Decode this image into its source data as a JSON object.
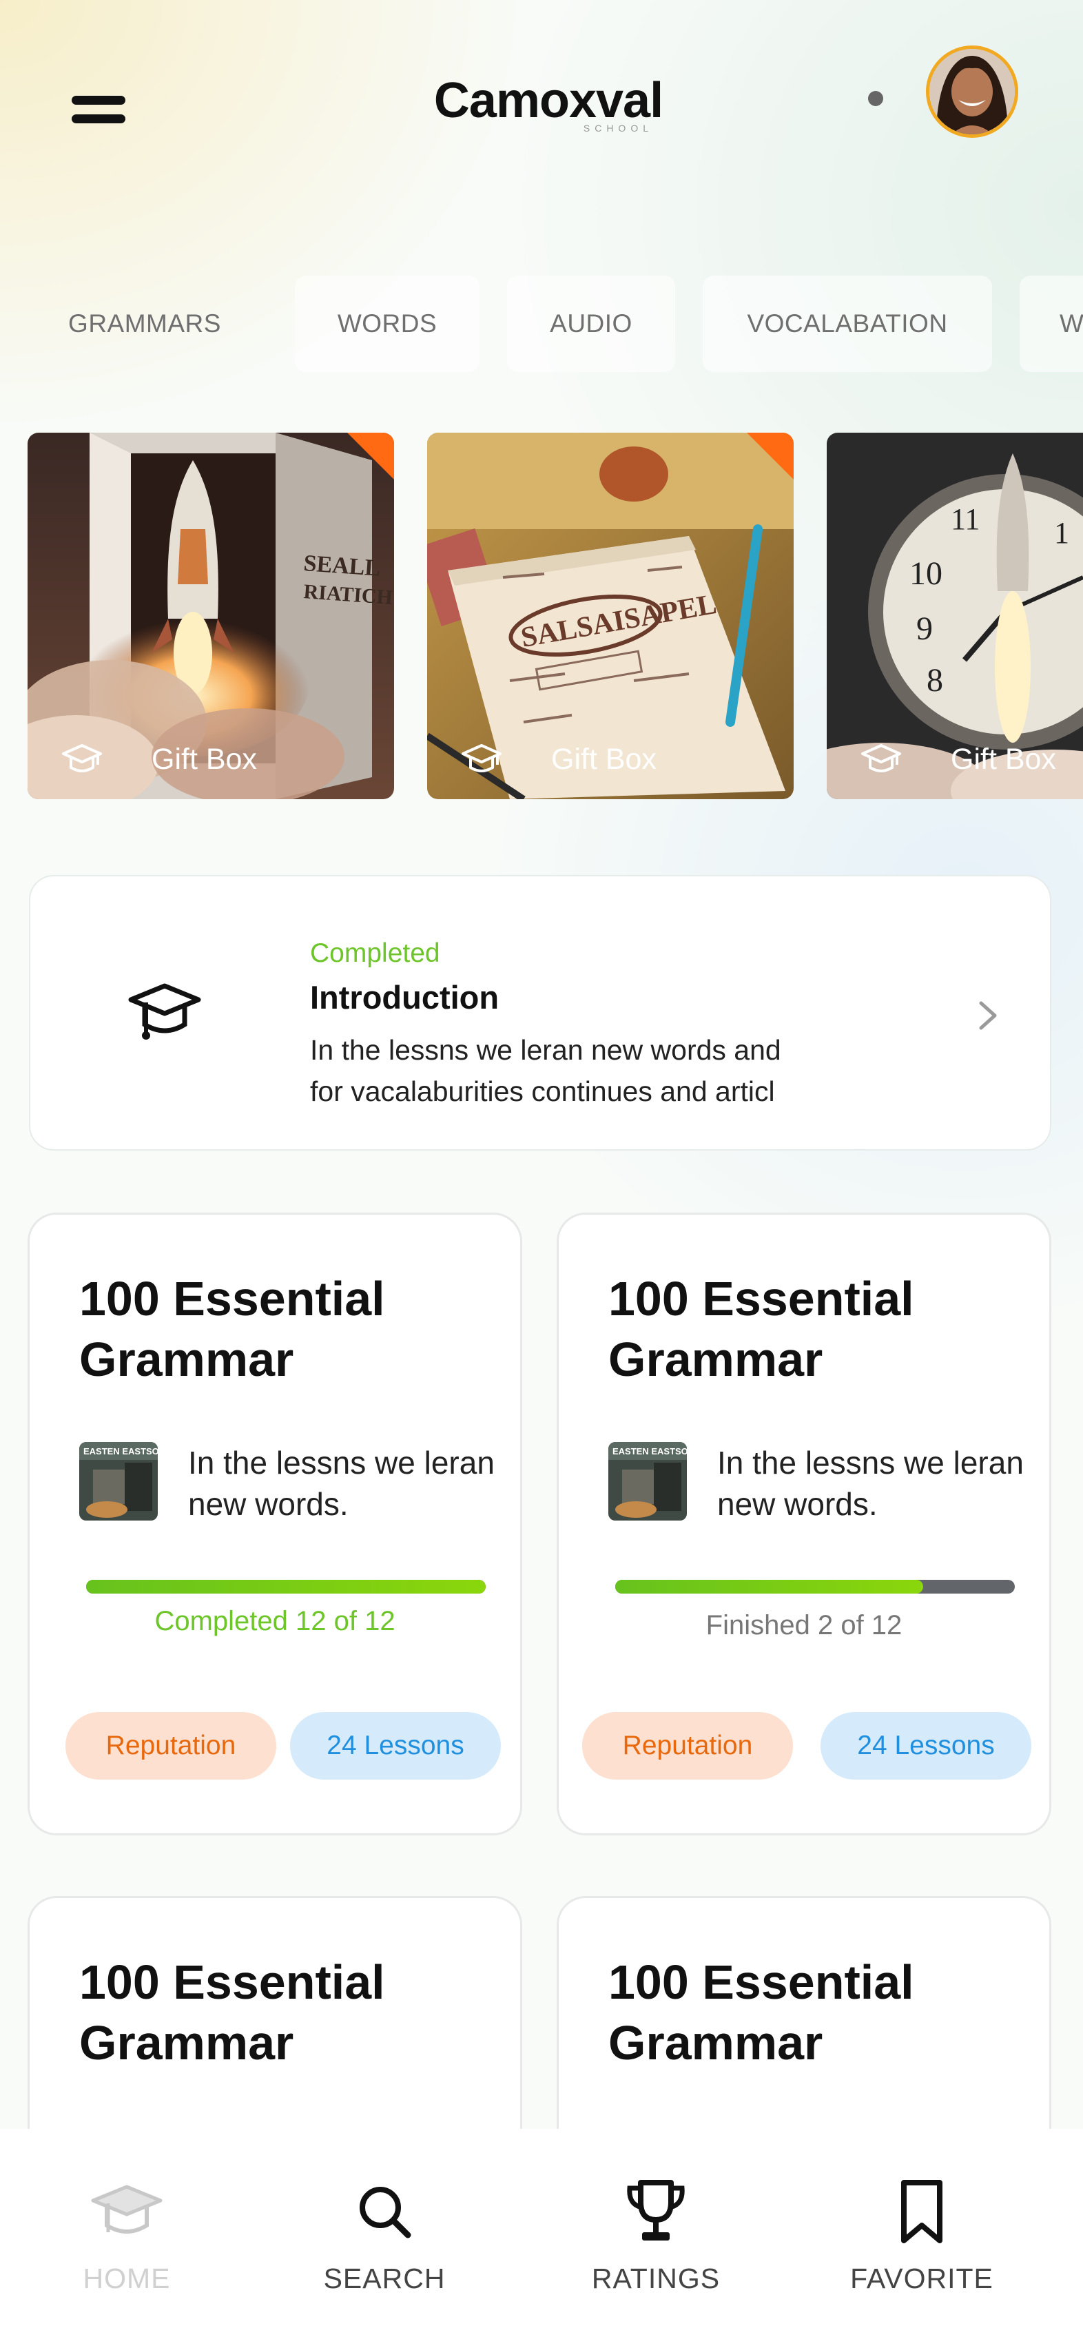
{
  "header": {
    "brand": "Camoxval",
    "brand_sub": "SCHOOL"
  },
  "tabs": [
    {
      "label": "GRAMMARS"
    },
    {
      "label": "WORDS"
    },
    {
      "label": "AUDIO"
    },
    {
      "label": "VOCALABATION"
    },
    {
      "label": "W"
    }
  ],
  "gift_cards": [
    {
      "label": "Gift Box"
    },
    {
      "label": "Gift Box"
    },
    {
      "label": "Gift Box"
    }
  ],
  "intro": {
    "status": "Completed",
    "title": "Introduction",
    "description_line1": "In the lessns we leran new words and",
    "description_line2": "for vacalaburities continues and articl"
  },
  "courses": [
    {
      "title": "100 Essential Grammar",
      "description": "In the lessns we leran new words.",
      "thumbnail_text": "EASTEN EASTSON",
      "progress_text": "Completed 12 of 12",
      "progress_fraction": 1.0,
      "tag1": "Reputation",
      "tag2": "24 Lessons"
    },
    {
      "title": "100 Essential Grammar",
      "description": "In the lessns we leran new words.",
      "thumbnail_text": "EASTEN EASTSON",
      "progress_text": "Finished 2 of 12",
      "progress_fraction": 0.77,
      "tag1": "Reputation",
      "tag2": "24 Lessons"
    },
    {
      "title": "100 Essential Grammar"
    },
    {
      "title": "100 Essential Grammar"
    }
  ],
  "bottom_nav": [
    {
      "label": "HOME",
      "icon": "graduation-cap-icon",
      "active": true
    },
    {
      "label": "SEARCH",
      "icon": "search-icon"
    },
    {
      "label": "RATINGS",
      "icon": "trophy-icon"
    },
    {
      "label": "FAVORITE",
      "icon": "bookmark-icon"
    }
  ],
  "colors": {
    "completed_green": "#6dc52a",
    "reputation_orange": "#e8690d",
    "lessons_blue": "#1f8fde",
    "avatar_ring": "#f1a922"
  }
}
